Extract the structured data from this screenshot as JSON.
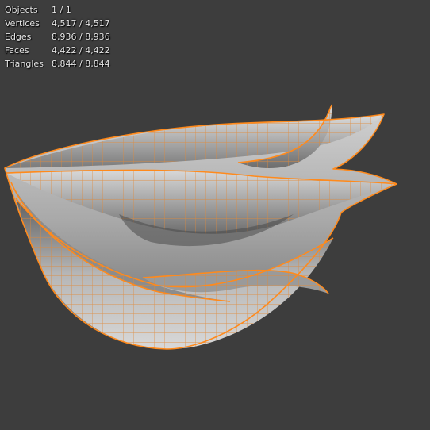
{
  "stats": [
    {
      "label": "Objects",
      "value": "1 / 1"
    },
    {
      "label": "Vertices",
      "value": "4,517 / 4,517"
    },
    {
      "label": "Edges",
      "value": "8,936 / 8,936"
    },
    {
      "label": "Faces",
      "value": "4,422 / 4,422"
    },
    {
      "label": "Triangles",
      "value": "8,844 / 8,844"
    }
  ],
  "colors": {
    "background": "#3d3d3d",
    "selection_outline": "#ff8a1c",
    "mesh_wire": "#e08a3a",
    "mesh_shade_light": "#d2d2d2",
    "mesh_shade_dark": "#5e5e5e"
  }
}
